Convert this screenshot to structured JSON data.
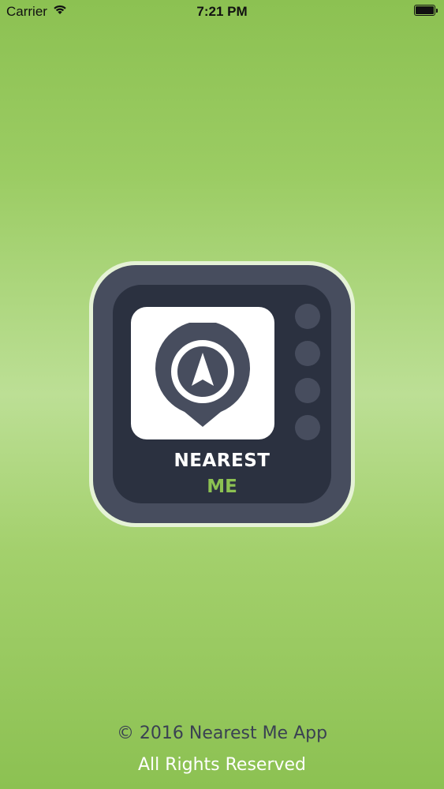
{
  "status_bar": {
    "carrier": "Carrier",
    "time": "7:21 PM",
    "wifi_icon": "wifi-icon",
    "battery_icon": "battery-icon"
  },
  "splash": {
    "app_icon": "location-pin-icon",
    "brand_line1": "NEAREST",
    "brand_line2": "ME"
  },
  "footer": {
    "copyright": "© 2016 Nearest Me App",
    "rights": "All Rights Reserved"
  },
  "colors": {
    "background": "#8cc152",
    "icon_dark": "#2b3140",
    "icon_frame": "#474d5e",
    "accent_green": "#8cc152"
  }
}
